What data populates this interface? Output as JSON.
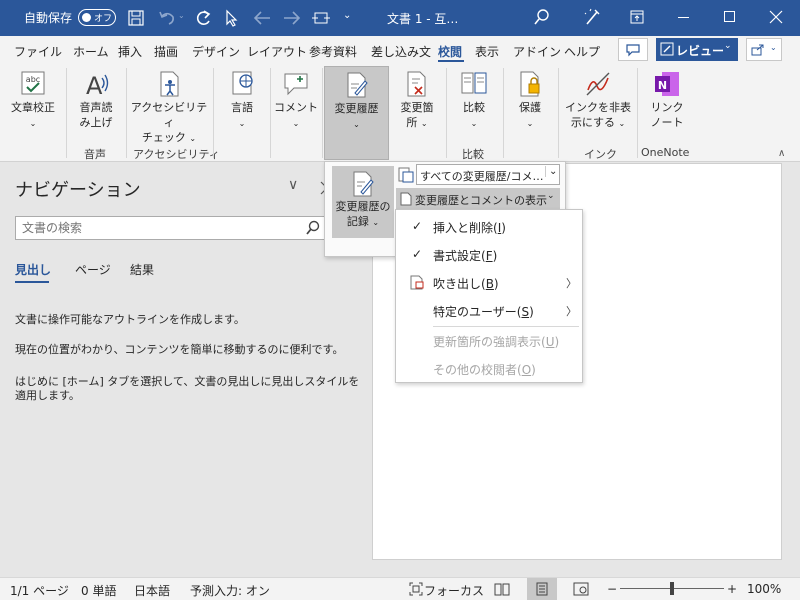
{
  "titlebar": {
    "autosave_label": "自動保存",
    "autosave_toggle": "オフ",
    "doc_title": "文書 1 - 互…",
    "colors": {
      "bg": "#2b579a",
      "text": "#ffffff"
    }
  },
  "tabs": {
    "items": [
      "ファイル",
      "ホーム",
      "挿入",
      "描画",
      "デザイン",
      "レイアウト",
      "参考資料",
      "差し込み文",
      "校閲",
      "表示",
      "アドイン",
      "ヘルプ"
    ],
    "active": "校閲",
    "review_button": "レビュー"
  },
  "ribbon": {
    "buttons": {
      "proofing": "文章校正",
      "read_aloud_1": "音声読",
      "read_aloud_2": "み上げ",
      "accessibility_1": "アクセシビリティ",
      "accessibility_2": "チェック",
      "language": "言語",
      "comment": "コメント",
      "track_changes": "変更履歴",
      "changes_1": "変更箇",
      "changes_2": "所",
      "compare": "比較",
      "protect": "保護",
      "ink_1": "インクを非表",
      "ink_2": "示にする",
      "linked_1": "リンク",
      "linked_2": "ノート"
    },
    "groups": {
      "speech": "音声",
      "accessibility": "アクセシビリティ",
      "compare": "比較",
      "ink": "インク",
      "onenote": "OneNote"
    }
  },
  "navigation": {
    "title": "ナビゲーション",
    "search_placeholder": "文書の検索",
    "tabs": [
      "見出し",
      "ページ",
      "結果"
    ],
    "messages": [
      "文書に操作可能なアウトラインを作成します。",
      "現在の位置がわかり、コンテンツを簡単に移動するのに便利です。",
      "はじめに [ホーム] タブを選択して、文書の見出しに見出しスタイルを",
      "適用します。"
    ]
  },
  "track_dropdown": {
    "record_1": "変更履歴の",
    "record_2": "記録",
    "markup_select": "すべての変更履歴/コメ…",
    "show_markup": "変更履歴とコメントの表示"
  },
  "markup_menu": {
    "items": [
      {
        "label": "挿入と削除(",
        "key": "I",
        "tail": ")",
        "checked": true,
        "disabled": false,
        "submenu": false
      },
      {
        "label": "書式設定(",
        "key": "F",
        "tail": ")",
        "checked": true,
        "disabled": false,
        "submenu": false
      },
      {
        "label": "吹き出し(",
        "key": "B",
        "tail": ")",
        "checked": false,
        "disabled": false,
        "submenu": true
      },
      {
        "label": "特定のユーザー(",
        "key": "S",
        "tail": ")",
        "checked": false,
        "disabled": false,
        "submenu": true
      },
      {
        "label": "更新箇所の強調表示(",
        "key": "U",
        "tail": ")",
        "checked": false,
        "disabled": true,
        "submenu": false
      },
      {
        "label": "その他の校閲者(",
        "key": "O",
        "tail": ")",
        "checked": false,
        "disabled": true,
        "submenu": false
      }
    ]
  },
  "statusbar": {
    "page": "1/1 ページ",
    "words": "0 単語",
    "language": "日本語",
    "predict": "予測入力: オン",
    "focus": "フォーカス",
    "zoom": "100%",
    "zoom_minus": "−",
    "zoom_plus": "+"
  }
}
